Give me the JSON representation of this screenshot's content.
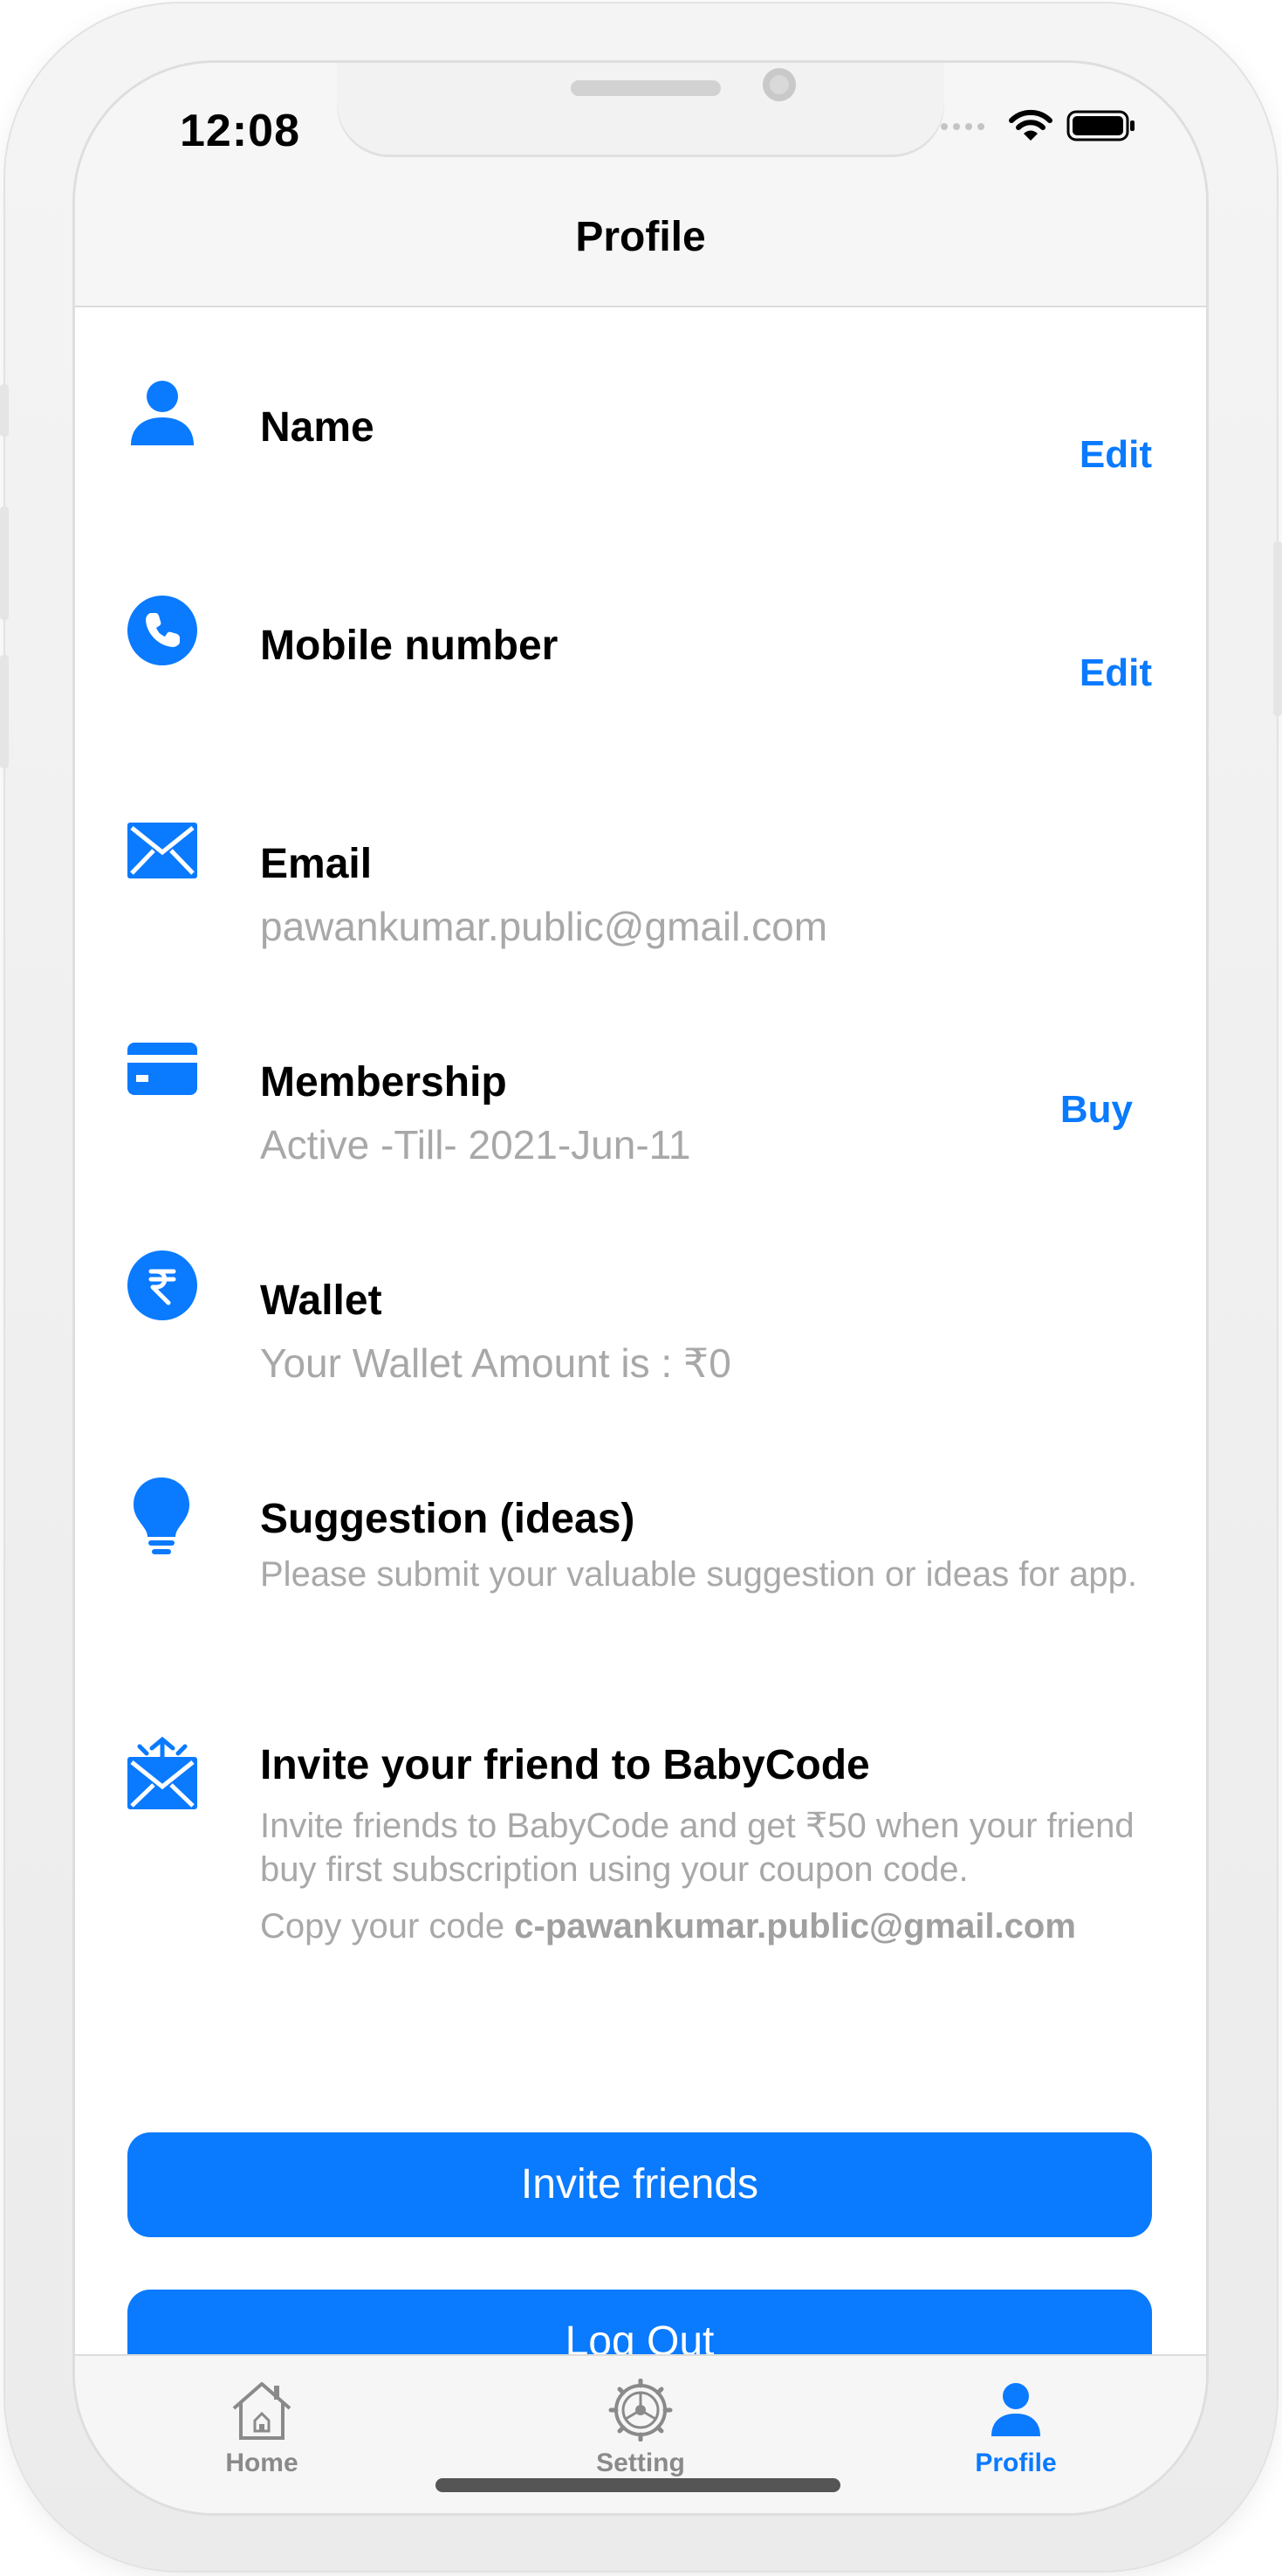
{
  "status_bar": {
    "time": "12:08"
  },
  "header": {
    "title": "Profile"
  },
  "rows": [
    {
      "icon": "person-icon",
      "title": "Name",
      "subtitle": "",
      "action": "Edit"
    },
    {
      "icon": "phone-icon",
      "title": "Mobile number",
      "subtitle": "",
      "action": "Edit"
    },
    {
      "icon": "mail-icon",
      "title": "Email",
      "subtitle": "pawankumar.public@gmail.com",
      "action": ""
    },
    {
      "icon": "credit-card-icon",
      "title": "Membership",
      "subtitle": "Active -Till- 2021-Jun-11",
      "action": "Buy"
    },
    {
      "icon": "rupee-icon",
      "title": "Wallet",
      "subtitle": "Your Wallet Amount is : ₹0",
      "action": ""
    },
    {
      "icon": "lightbulb-icon",
      "title": "Suggestion (ideas)",
      "subtitle": "Please submit your valuable suggestion or ideas for app.",
      "action": ""
    },
    {
      "icon": "invite-mail-icon",
      "title": "Invite your friend to BabyCode",
      "subtitle": "Invite friends to BabyCode and get ₹50 when your friend buy first subscription using your coupon code.",
      "action": ""
    }
  ],
  "invite": {
    "code_prefix": "Copy your code ",
    "code": "c-pawankumar.public@gmail.com"
  },
  "buttons": {
    "invite_friends": "Invite friends",
    "log_out": "Log Out"
  },
  "tabs": [
    {
      "label": "Home",
      "icon": "home-icon",
      "active": false
    },
    {
      "label": "Setting",
      "icon": "gear-icon",
      "active": false
    },
    {
      "label": "Profile",
      "icon": "person-icon",
      "active": true
    }
  ],
  "colors": {
    "accent": "#0a7aff",
    "subtitle": "#a8a8a8",
    "tab_inactive": "#8a8a8a",
    "bar_background": "#f6f6f6"
  }
}
